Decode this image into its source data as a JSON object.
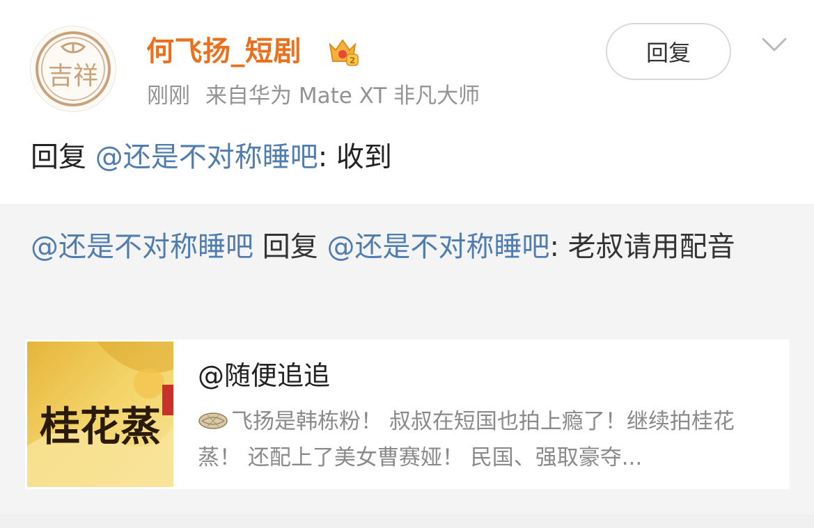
{
  "post": {
    "username": "何飞扬_短剧",
    "avatar_text": "吉祥",
    "time": "刚刚",
    "source": "来自华为 Mate XT 非凡大师",
    "reply_button_label": "回复",
    "reply_prefix": "回复",
    "reply_mention": "@还是不对称睡吧",
    "reply_body": ": 收到"
  },
  "quote": {
    "mention1": "@还是不对称睡吧",
    "mid_text": " 回复 ",
    "mention2": "@还是不对称睡吧",
    "body": ": 老叔请用配音"
  },
  "card": {
    "title": "@随便追追",
    "description": "飞扬是韩栋粉！ 叔叔在短国也拍上瘾了！继续拍桂花蒸！ 还配上了美女曹赛娅！ 民国、强取豪夺...",
    "thumbnail_title": "桂花蒸",
    "emoji_icon": "melon-emoji-icon"
  },
  "colors": {
    "username": "#e9701c",
    "mention": "#507daf",
    "meta": "#939393"
  }
}
